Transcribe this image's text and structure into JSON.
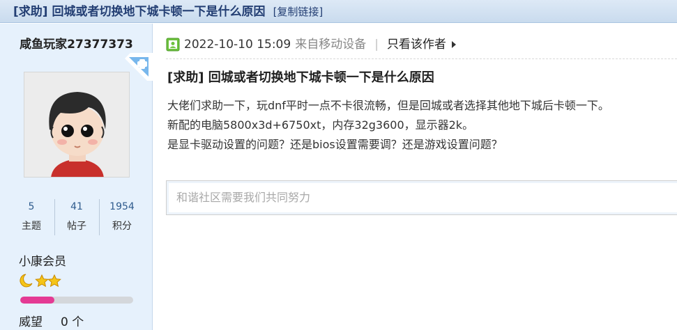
{
  "thread": {
    "title": "[求助] 回城或者切换地下城卡顿一下是什么原因",
    "copy_link": "[复制链接]"
  },
  "author": {
    "username": "咸鱼玩家27377373",
    "stats": [
      {
        "value": "5",
        "label": "主题"
      },
      {
        "value": "41",
        "label": "帖子"
      },
      {
        "value": "1954",
        "label": "积分"
      }
    ],
    "rank": "小康会员",
    "level_progress": 0.3,
    "prestige_label": "威望",
    "prestige_value": "0 个",
    "colors": {
      "progress_fill": "#e43a94",
      "sidebar_bg": "#e6f1fc"
    }
  },
  "post": {
    "date": "2022-10-10 15:09",
    "source": "来自移动设备",
    "separator": "|",
    "only_author": "只看该作者",
    "title": "[求助] 回城或者切换地下城卡顿一下是什么原因",
    "body": [
      "大佬们求助一下，玩dnf平时一点不卡很流畅，但是回城或者选择其他地下城后卡顿一下。",
      "新配的电脑5800x3d+6750xt，内存32g3600，显示器2k。",
      "是显卡驱动设置的问题？还是bios设置需要调？还是游戏设置问题？"
    ]
  },
  "reply": {
    "placeholder": "和谐社区需要我们共同努力"
  }
}
